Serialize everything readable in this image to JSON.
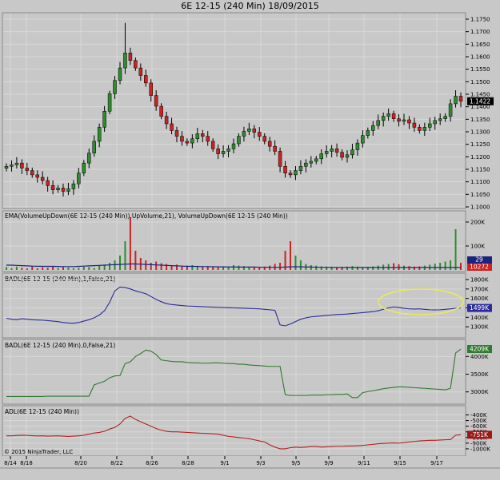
{
  "header": {
    "title": "6E 12-15 (240 Min)  18/09/2015"
  },
  "copyright": "© 2015 NinjaTrader, LLC",
  "colors": {
    "background": "#c8c8c8",
    "grid": "#d8d8d8",
    "up": "#2e8b2e",
    "down": "#cc2222",
    "ema_line": "#1a237e",
    "badl1_line": "#2b2b9c",
    "badl0_line": "#2f7a2f",
    "adl_line": "#b22222",
    "highlight": "#e8e860"
  },
  "chart_data": [
    {
      "type": "candlestick",
      "title": "6E 12-15 (240 Min)",
      "x_dates": [
        "8/14",
        "8/18",
        "8/20",
        "8/22",
        "8/26",
        "8/28",
        "9/1",
        "9/3",
        "9/5",
        "9/9",
        "9/11",
        "9/15",
        "9/17"
      ],
      "ylim": [
        1.1,
        1.175
      ],
      "yticks": [
        "1.1000",
        "1.1050",
        "1.1100",
        "1.1150",
        "1.1200",
        "1.1250",
        "1.1300",
        "1.1350",
        "1.1400",
        "1.1450",
        "1.1500",
        "1.1550",
        "1.1600",
        "1.1650",
        "1.1700",
        "1.1750"
      ],
      "last_value": "1.1422",
      "close_path": [
        1.1162,
        1.1168,
        1.1175,
        1.1155,
        1.1145,
        1.1128,
        1.1118,
        1.1105,
        1.1085,
        1.1068,
        1.1075,
        1.1062,
        1.1072,
        1.1092,
        1.1135,
        1.1175,
        1.1215,
        1.1262,
        1.1318,
        1.1382,
        1.1452,
        1.1505,
        1.1555,
        1.1615,
        1.1585,
        1.1555,
        1.1525,
        1.1495,
        1.1445,
        1.1402,
        1.1362,
        1.1332,
        1.1305,
        1.1282,
        1.1262,
        1.1255,
        1.1272,
        1.1292,
        1.1282,
        1.1262,
        1.1232,
        1.1212,
        1.1222,
        1.1232,
        1.1252,
        1.1282,
        1.1302,
        1.1312,
        1.1298,
        1.1282,
        1.1262,
        1.1242,
        1.1222,
        1.1162,
        1.1135,
        1.1128,
        1.1145,
        1.1162,
        1.1175,
        1.1182,
        1.1192,
        1.1212,
        1.1222,
        1.1232,
        1.1218,
        1.1198,
        1.1208,
        1.1228,
        1.1255,
        1.1285,
        1.1305,
        1.1325,
        1.1345,
        1.1362,
        1.1372,
        1.1352,
        1.1342,
        1.1348,
        1.1335,
        1.1318,
        1.1305,
        1.1318,
        1.1332,
        1.1345,
        1.1352,
        1.1362,
        1.1412,
        1.1442,
        1.1422
      ]
    },
    {
      "type": "bar",
      "title": "EMA(VolumeUpDown(6E 12-15 (240 Min)).UpVolume,21), VolumeUpDown(6E 12-15 (240 Min))",
      "ylim": [
        0,
        220000
      ],
      "yticks": [
        "100K",
        "200K"
      ],
      "last_values": [
        "10272",
        "29"
      ],
      "bar_values": [
        12000,
        8000,
        14000,
        9000,
        6000,
        15000,
        7000,
        11000,
        9000,
        16000,
        8000,
        12000,
        10000,
        7000,
        9000,
        14000,
        12000,
        8000,
        20000,
        22000,
        30000,
        40000,
        60000,
        120000,
        220000,
        80000,
        50000,
        40000,
        30000,
        35000,
        28000,
        25000,
        18000,
        22000,
        15000,
        18000,
        20000,
        17000,
        14000,
        16000,
        12000,
        15000,
        14000,
        12000,
        20000,
        18000,
        16000,
        14000,
        12000,
        10000,
        14000,
        18000,
        25000,
        30000,
        80000,
        120000,
        60000,
        40000,
        25000,
        20000,
        18000,
        15000,
        14000,
        13000,
        12000,
        12000,
        14000,
        16000,
        14000,
        12000,
        13000,
        15000,
        18000,
        22000,
        25000,
        28000,
        24000,
        18000,
        16000,
        14000,
        15000,
        18000,
        22000,
        26000,
        30000,
        35000,
        40000,
        170000,
        30000
      ],
      "ema_values": [
        20000,
        20000,
        19000,
        18000,
        17000,
        16000,
        15500,
        15000,
        15000,
        15000,
        14500,
        14000,
        14000,
        14000,
        15000,
        16000,
        17000,
        18000,
        19000,
        20000,
        21000,
        22000,
        23000,
        24000,
        25000,
        25000,
        24000,
        23000,
        22000,
        21000,
        20000,
        19000,
        18000,
        17000,
        16000,
        15000,
        15000,
        14500,
        14000,
        14000,
        13500,
        13000,
        13000,
        12500,
        12500,
        12000,
        12000,
        12000,
        12000,
        11500,
        11500,
        11500,
        11000,
        11000,
        12000,
        13000,
        13500,
        13000,
        12500,
        12000,
        11500,
        11000,
        11000,
        10800,
        10600,
        10500,
        10500,
        10500,
        10400,
        10300,
        10300,
        10300,
        10300,
        10300,
        10300,
        10300,
        10300,
        10300,
        10300,
        10300,
        10300,
        10300,
        10300,
        10300,
        10300,
        10300,
        10300,
        10300,
        10300
      ]
    },
    {
      "type": "line",
      "title": "BADL(6E 12-15 (240 Min),1,False,21)",
      "ylim": [
        1200,
        1800
      ],
      "yticks": [
        "1300K",
        "1400K",
        "1500K",
        "1600K",
        "1700K",
        "1800K"
      ],
      "last_value": "1499K",
      "values": [
        1390,
        1380,
        1375,
        1385,
        1380,
        1375,
        1372,
        1370,
        1365,
        1360,
        1355,
        1345,
        1340,
        1338,
        1345,
        1360,
        1375,
        1395,
        1425,
        1470,
        1560,
        1680,
        1720,
        1715,
        1700,
        1680,
        1665,
        1650,
        1620,
        1590,
        1565,
        1545,
        1535,
        1530,
        1525,
        1520,
        1518,
        1515,
        1512,
        1510,
        1508,
        1506,
        1504,
        1502,
        1500,
        1498,
        1496,
        1494,
        1492,
        1490,
        1485,
        1480,
        1475,
        1320,
        1310,
        1330,
        1355,
        1380,
        1395,
        1405,
        1410,
        1415,
        1420,
        1425,
        1430,
        1432,
        1435,
        1440,
        1445,
        1450,
        1455,
        1460,
        1470,
        1485,
        1500,
        1510,
        1505,
        1495,
        1490,
        1488,
        1490,
        1485,
        1480,
        1478,
        1480,
        1485,
        1490,
        1495,
        1499
      ]
    },
    {
      "type": "line",
      "title": "BADL(6E 12-15 (240 Min),0,False,21)",
      "ylim": [
        2700,
        4300
      ],
      "yticks": [
        "3000K",
        "3500K",
        "4000K"
      ],
      "last_value": "4209K",
      "values": [
        2870,
        2870,
        2870,
        2870,
        2870,
        2870,
        2870,
        2870,
        2880,
        2880,
        2880,
        2880,
        2880,
        2880,
        2880,
        2880,
        2880,
        3200,
        3250,
        3300,
        3400,
        3450,
        3460,
        3800,
        3850,
        4000,
        4080,
        4180,
        4150,
        4050,
        3900,
        3880,
        3860,
        3850,
        3850,
        3830,
        3820,
        3820,
        3810,
        3810,
        3820,
        3820,
        3810,
        3800,
        3800,
        3780,
        3780,
        3760,
        3750,
        3740,
        3730,
        3720,
        3720,
        3720,
        2920,
        2900,
        2900,
        2900,
        2900,
        2910,
        2910,
        2910,
        2920,
        2920,
        2930,
        2930,
        2940,
        2840,
        2840,
        2980,
        3010,
        3030,
        3060,
        3090,
        3110,
        3130,
        3140,
        3140,
        3130,
        3120,
        3110,
        3100,
        3090,
        3080,
        3070,
        3060,
        3100,
        4100,
        4209
      ]
    },
    {
      "type": "line",
      "title": "ADL(6E 12-15 (240 Min))",
      "ylim": [
        -1100,
        -350
      ],
      "yticks": [
        "-400K",
        "-500K",
        "-600K",
        "-700K",
        "-800K",
        "-900K",
        "-1000K"
      ],
      "last_value": "-751K",
      "values": [
        -770,
        -770,
        -765,
        -760,
        -762,
        -768,
        -772,
        -770,
        -775,
        -772,
        -770,
        -775,
        -780,
        -775,
        -770,
        -760,
        -740,
        -720,
        -710,
        -690,
        -650,
        -620,
        -560,
        -460,
        -420,
        -480,
        -520,
        -560,
        -600,
        -640,
        -670,
        -690,
        -700,
        -700,
        -705,
        -710,
        -715,
        -720,
        -725,
        -730,
        -735,
        -740,
        -760,
        -780,
        -790,
        -800,
        -810,
        -820,
        -840,
        -860,
        -880,
        -930,
        -970,
        -1000,
        -1000,
        -980,
        -970,
        -975,
        -970,
        -960,
        -960,
        -970,
        -965,
        -960,
        -955,
        -955,
        -950,
        -950,
        -945,
        -940,
        -930,
        -920,
        -910,
        -905,
        -900,
        -895,
        -900,
        -890,
        -880,
        -870,
        -860,
        -855,
        -850,
        -850,
        -845,
        -840,
        -835,
        -760,
        -751
      ]
    }
  ]
}
